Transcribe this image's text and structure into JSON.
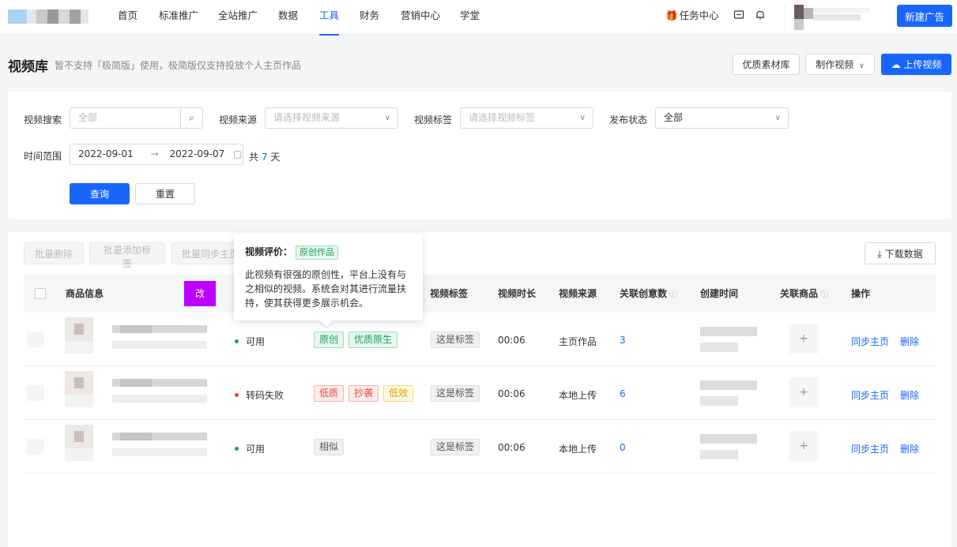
{
  "nav": {
    "items": [
      "首页",
      "标准推广",
      "全站推广",
      "数据",
      "工具",
      "财务",
      "营销中心",
      "学堂"
    ],
    "active_index": 4,
    "task_center": "任务中心",
    "new_ad_button": "新建广告"
  },
  "header": {
    "title": "视频库",
    "subtitle": "暂不支持「极简版」使用，极简版仅支持投放个人主页作品",
    "buttons": {
      "quality_library": "优质素材库",
      "make_video": "制作视频",
      "upload_video": "上传视频"
    }
  },
  "filters": {
    "search": {
      "label": "视频搜索",
      "placeholder": "全部"
    },
    "source": {
      "label": "视频来源",
      "placeholder": "请选择视频来源"
    },
    "tag": {
      "label": "视频标签",
      "placeholder": "请选择视频标签"
    },
    "status": {
      "label": "发布状态",
      "value": "全部"
    },
    "time_range": {
      "label": "时间范围",
      "start": "2022-09-01",
      "end": "2022-09-07",
      "total_prefix": "共",
      "total_days": "7",
      "total_suffix": "天"
    },
    "query_button": "查询",
    "reset_button": "重置"
  },
  "toolbar": {
    "batch_delete": "批量删除",
    "batch_add_tag": "批量添加标签",
    "batch_sync": "批量同步主页",
    "download": "下载数据"
  },
  "table": {
    "columns": {
      "product": "商品信息",
      "edit_badge": "改",
      "video_tag": "视频标签",
      "duration": "视频时长",
      "source": "视频来源",
      "creatives": "关联创意数",
      "created": "创建时间",
      "linked_product": "关联商品",
      "actions": "操作"
    },
    "rows": [
      {
        "status": "可用",
        "status_color": "#18a058",
        "badges": [
          {
            "text": "原创",
            "tone": "green"
          },
          {
            "text": "优质原生",
            "tone": "green"
          }
        ],
        "tag": "这是标签",
        "duration": "00:06",
        "source": "主页作品",
        "creatives": "3",
        "action_sync": "同步主页",
        "action_delete": "删除"
      },
      {
        "status": "转码失败",
        "status_color": "#e8463a",
        "badges": [
          {
            "text": "低质",
            "tone": "red"
          },
          {
            "text": "抄袭",
            "tone": "red"
          },
          {
            "text": "低效",
            "tone": "yellow"
          }
        ],
        "tag": "这是标签",
        "duration": "00:06",
        "source": "本地上传",
        "creatives": "6",
        "action_sync": "同步主页",
        "action_delete": "删除"
      },
      {
        "status": "可用",
        "status_color": "#18a058",
        "badges": [
          {
            "text": "相似",
            "tone": "gray"
          }
        ],
        "tag": "这是标签",
        "duration": "00:06",
        "source": "本地上传",
        "creatives": "0",
        "action_sync": "同步主页",
        "action_delete": "删除"
      }
    ]
  },
  "tooltip": {
    "heading": "视频评价：",
    "tag": "原创作品",
    "body": "此视频有很强的原创性，平台上没有与之相似的视频。系统会对其进行流量扶持，使其获得更多展示机会。"
  },
  "colors": {
    "accent": "#1966ff",
    "purple_badge": "#bb00ff"
  }
}
